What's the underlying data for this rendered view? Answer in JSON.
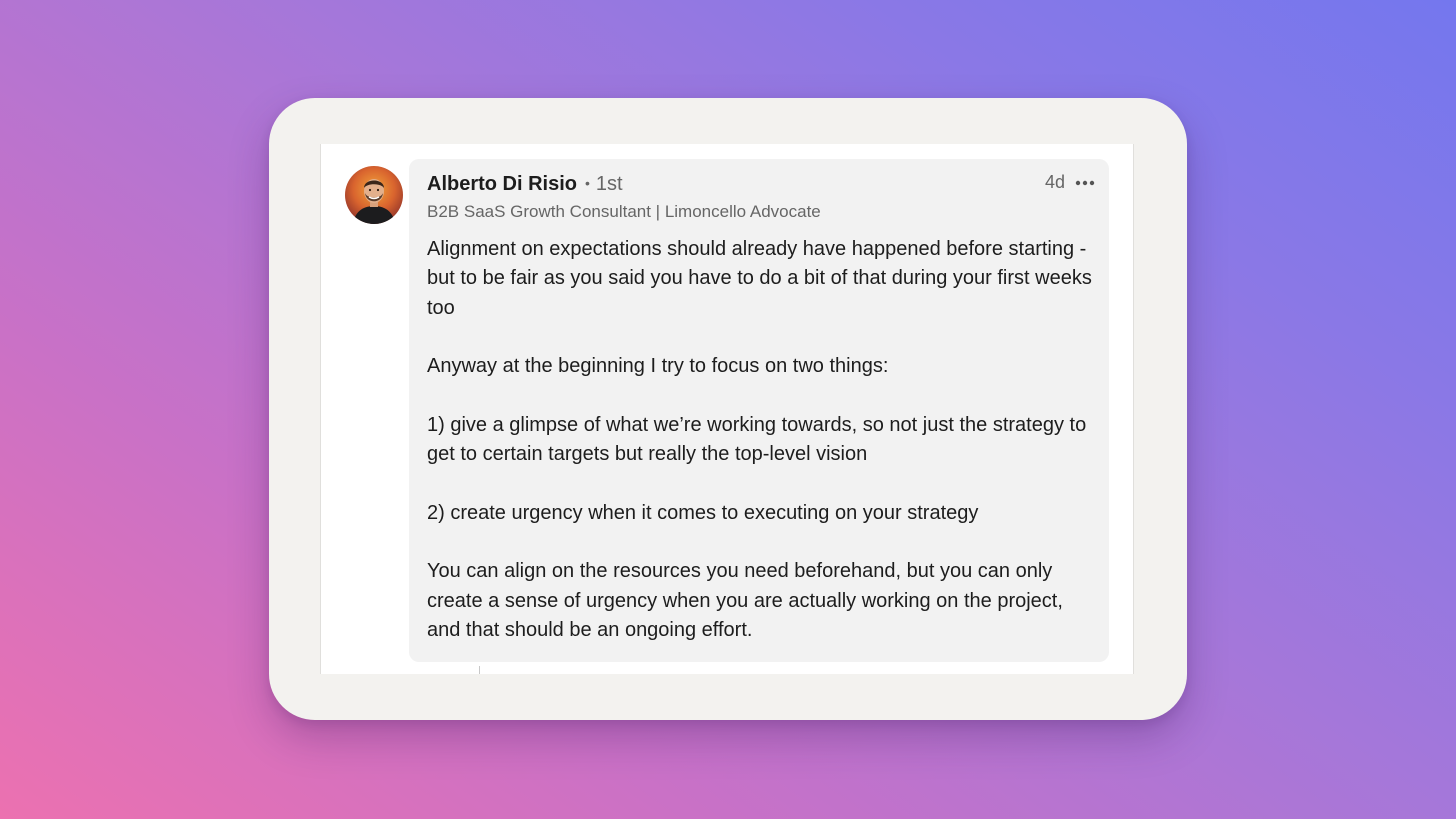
{
  "comment": {
    "author_name": "Alberto Di Risio",
    "degree_separator": "•",
    "connection_degree": "1st",
    "headline": "B2B SaaS Growth Consultant | Limoncello Advocate",
    "timestamp": "4d",
    "more_icon": "ellipsis-horizontal-icon",
    "avatar_icon": "profile-photo",
    "paragraphs": [
      "Alignment on expectations should already have happened before starting - but to be fair as you said you have to do a bit of that during your first weeks too",
      "Anyway at the beginning I try to focus on two things:",
      "1) give a glimpse of what we’re working towards, so not just the strategy to get to certain targets but really the top-level vision",
      "2) create urgency when it comes to executing on your strategy",
      "You can align on the resources you need beforehand, but you can only create a sense of urgency when you are actually working on the project, and that should be an ongoing effort."
    ]
  },
  "colors": {
    "bubble_background": "#f2f2f2",
    "frame_background": "#f3f2ef",
    "text_primary": "#1d1d1d",
    "text_secondary": "#666666"
  }
}
